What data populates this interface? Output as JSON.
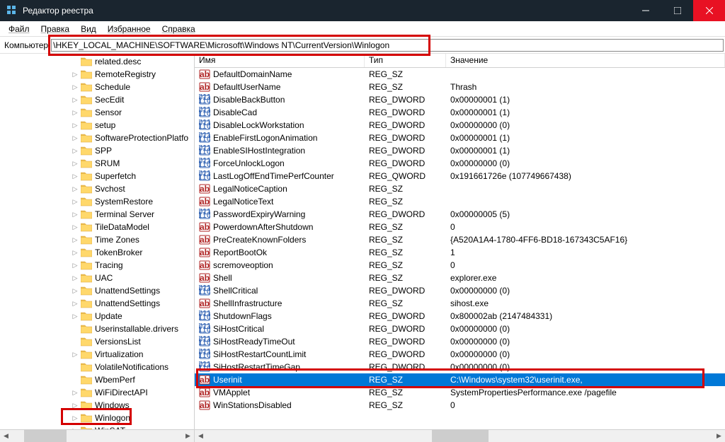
{
  "window": {
    "title": "Редактор реестра"
  },
  "menu": {
    "file": "Файл",
    "edit": "Правка",
    "view": "Вид",
    "favorites": "Избранное",
    "help": "Справка"
  },
  "addressbar": {
    "label": "Компьютер",
    "path": "\\HKEY_LOCAL_MACHINE\\SOFTWARE\\Microsoft\\Windows NT\\CurrentVersion\\Winlogon"
  },
  "tree": {
    "items": [
      {
        "label": "related.desc",
        "expander": ""
      },
      {
        "label": "RemoteRegistry",
        "expander": "▷"
      },
      {
        "label": "Schedule",
        "expander": "▷"
      },
      {
        "label": "SecEdit",
        "expander": "▷"
      },
      {
        "label": "Sensor",
        "expander": "▷"
      },
      {
        "label": "setup",
        "expander": "▷"
      },
      {
        "label": "SoftwareProtectionPlatfo",
        "expander": "▷"
      },
      {
        "label": "SPP",
        "expander": "▷"
      },
      {
        "label": "SRUM",
        "expander": "▷"
      },
      {
        "label": "Superfetch",
        "expander": "▷"
      },
      {
        "label": "Svchost",
        "expander": "▷"
      },
      {
        "label": "SystemRestore",
        "expander": "▷"
      },
      {
        "label": "Terminal Server",
        "expander": "▷"
      },
      {
        "label": "TileDataModel",
        "expander": "▷"
      },
      {
        "label": "Time Zones",
        "expander": "▷"
      },
      {
        "label": "TokenBroker",
        "expander": "▷"
      },
      {
        "label": "Tracing",
        "expander": "▷"
      },
      {
        "label": "UAC",
        "expander": "▷"
      },
      {
        "label": "UnattendSettings",
        "expander": "▷"
      },
      {
        "label": "UnattendSettings",
        "expander": "▷"
      },
      {
        "label": "Update",
        "expander": "▷"
      },
      {
        "label": "Userinstallable.drivers",
        "expander": ""
      },
      {
        "label": "VersionsList",
        "expander": ""
      },
      {
        "label": "Virtualization",
        "expander": "▷"
      },
      {
        "label": "VolatileNotifications",
        "expander": ""
      },
      {
        "label": "WbemPerf",
        "expander": ""
      },
      {
        "label": "WiFiDirectAPI",
        "expander": "▷"
      },
      {
        "label": "Windows",
        "expander": "▷"
      },
      {
        "label": "Winlogon",
        "expander": "▷",
        "highlight": true
      },
      {
        "label": "WinSAT",
        "expander": "▷"
      }
    ]
  },
  "list": {
    "headers": {
      "name": "Имя",
      "type": "Тип",
      "data": "Значение"
    },
    "rows": [
      {
        "icon": "sz",
        "name": "DefaultDomainName",
        "type": "REG_SZ",
        "data": ""
      },
      {
        "icon": "sz",
        "name": "DefaultUserName",
        "type": "REG_SZ",
        "data": "Thrash"
      },
      {
        "icon": "dw",
        "name": "DisableBackButton",
        "type": "REG_DWORD",
        "data": "0x00000001 (1)"
      },
      {
        "icon": "dw",
        "name": "DisableCad",
        "type": "REG_DWORD",
        "data": "0x00000001 (1)"
      },
      {
        "icon": "dw",
        "name": "DisableLockWorkstation",
        "type": "REG_DWORD",
        "data": "0x00000000 (0)"
      },
      {
        "icon": "dw",
        "name": "EnableFirstLogonAnimation",
        "type": "REG_DWORD",
        "data": "0x00000001 (1)"
      },
      {
        "icon": "dw",
        "name": "EnableSIHostIntegration",
        "type": "REG_DWORD",
        "data": "0x00000001 (1)"
      },
      {
        "icon": "dw",
        "name": "ForceUnlockLogon",
        "type": "REG_DWORD",
        "data": "0x00000000 (0)"
      },
      {
        "icon": "dw",
        "name": "LastLogOffEndTimePerfCounter",
        "type": "REG_QWORD",
        "data": "0x191661726e (107749667438)"
      },
      {
        "icon": "sz",
        "name": "LegalNoticeCaption",
        "type": "REG_SZ",
        "data": ""
      },
      {
        "icon": "sz",
        "name": "LegalNoticeText",
        "type": "REG_SZ",
        "data": ""
      },
      {
        "icon": "dw",
        "name": "PasswordExpiryWarning",
        "type": "REG_DWORD",
        "data": "0x00000005 (5)"
      },
      {
        "icon": "sz",
        "name": "PowerdownAfterShutdown",
        "type": "REG_SZ",
        "data": "0"
      },
      {
        "icon": "sz",
        "name": "PreCreateKnownFolders",
        "type": "REG_SZ",
        "data": "{A520A1A4-1780-4FF6-BD18-167343C5AF16}"
      },
      {
        "icon": "sz",
        "name": "ReportBootOk",
        "type": "REG_SZ",
        "data": "1"
      },
      {
        "icon": "sz",
        "name": "scremoveoption",
        "type": "REG_SZ",
        "data": "0"
      },
      {
        "icon": "sz",
        "name": "Shell",
        "type": "REG_SZ",
        "data": "explorer.exe"
      },
      {
        "icon": "dw",
        "name": "ShellCritical",
        "type": "REG_DWORD",
        "data": "0x00000000 (0)"
      },
      {
        "icon": "sz",
        "name": "ShellInfrastructure",
        "type": "REG_SZ",
        "data": "sihost.exe"
      },
      {
        "icon": "dw",
        "name": "ShutdownFlags",
        "type": "REG_DWORD",
        "data": "0x800002ab (2147484331)"
      },
      {
        "icon": "dw",
        "name": "SiHostCritical",
        "type": "REG_DWORD",
        "data": "0x00000000 (0)"
      },
      {
        "icon": "dw",
        "name": "SiHostReadyTimeOut",
        "type": "REG_DWORD",
        "data": "0x00000000 (0)"
      },
      {
        "icon": "dw",
        "name": "SiHostRestartCountLimit",
        "type": "REG_DWORD",
        "data": "0x00000000 (0)"
      },
      {
        "icon": "dw",
        "name": "SiHostRestartTimeGap",
        "type": "REG_DWORD",
        "data": "0x00000000 (0)"
      },
      {
        "icon": "sz",
        "name": "Userinit",
        "type": "REG_SZ",
        "data": "C:\\Windows\\system32\\userinit.exe,",
        "selected": true,
        "highlight": true
      },
      {
        "icon": "sz",
        "name": "VMApplet",
        "type": "REG_SZ",
        "data": "SystemPropertiesPerformance.exe /pagefile"
      },
      {
        "icon": "sz",
        "name": "WinStationsDisabled",
        "type": "REG_SZ",
        "data": "0"
      }
    ]
  }
}
